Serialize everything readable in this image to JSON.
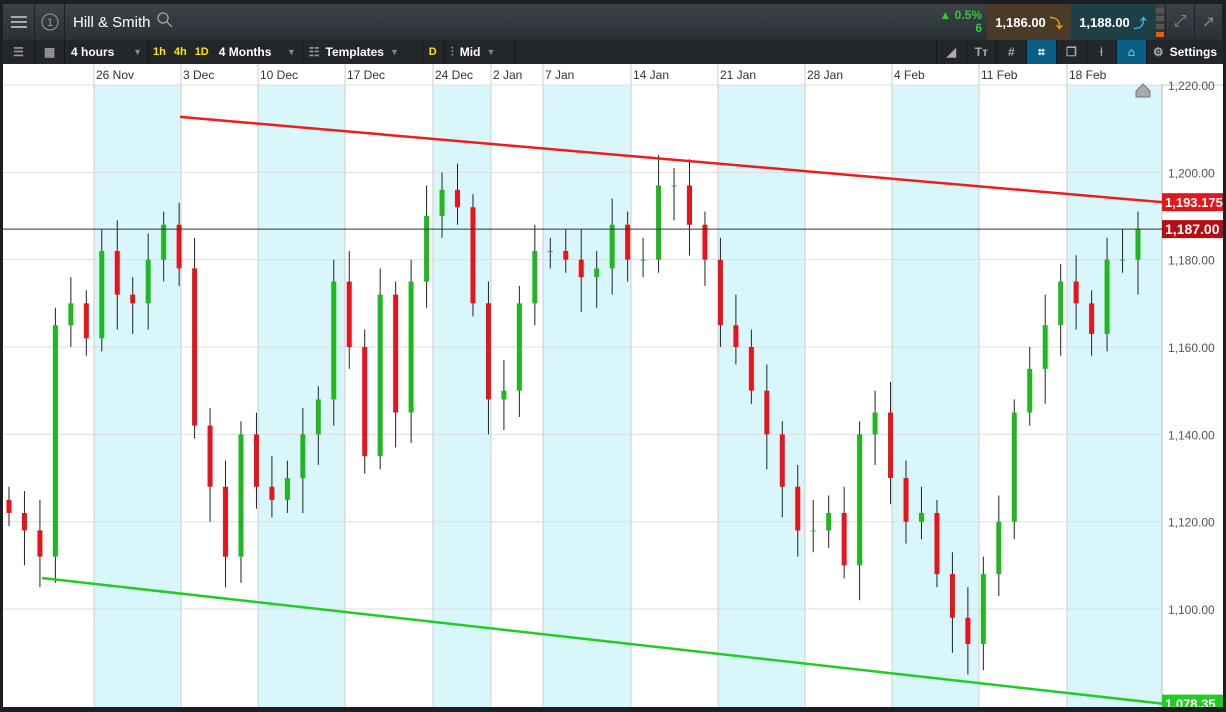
{
  "header": {
    "title": "Hill & Smith",
    "change_pct": "0.5%",
    "change_abs": "6",
    "sell_price": "1,186.00",
    "buy_price": "1,188.00"
  },
  "toolbar": {
    "interval": "4 hours",
    "quick": [
      "1h",
      "4h",
      "1D"
    ],
    "range": "4 Months",
    "templates": "Templates",
    "d_label": "D",
    "price_type": "Mid",
    "settings": "Settings"
  },
  "colors": {
    "up": "#1fb81f",
    "down": "#e8141b",
    "resistance": "#ee1c1c",
    "support": "#22cc22",
    "shade": "#d9f7fb"
  },
  "chart_data": {
    "type": "candlestick",
    "x_ticks": [
      "26 Nov",
      "3 Dec",
      "10 Dec",
      "17 Dec",
      "24 Dec",
      "2 Jan",
      "7 Jan",
      "14 Jan",
      "21 Jan",
      "28 Jan",
      "4 Feb",
      "11 Feb",
      "18 Feb"
    ],
    "y_ticks": [
      "1,220.00",
      "1,200.00",
      "1,180.00",
      "1,160.00",
      "1,140.00",
      "1,120.00",
      "1,100.00"
    ],
    "ylim": [
      1076,
      1224
    ],
    "closes": [
      1122,
      1118,
      1112,
      1165,
      1170,
      1162,
      1182,
      1172,
      1170,
      1180,
      1188,
      1178,
      1142,
      1128,
      1112,
      1140,
      1128,
      1125,
      1130,
      1140,
      1148,
      1175,
      1160,
      1135,
      1172,
      1145,
      1175,
      1190,
      1196,
      1192,
      1170,
      1148,
      1150,
      1170,
      1182,
      1182,
      1180,
      1176,
      1178,
      1188,
      1180,
      1180,
      1197,
      1197,
      1188,
      1180,
      1165,
      1160,
      1150,
      1140,
      1128,
      1118,
      1118,
      1122,
      1110,
      1140,
      1145,
      1130,
      1120,
      1122,
      1108,
      1098,
      1092,
      1108,
      1120,
      1145,
      1155,
      1165,
      1175,
      1170,
      1163,
      1180,
      1180,
      1187
    ],
    "resistance_line": {
      "start": 1212.7,
      "end": 1193.17,
      "label": "1,193.175"
    },
    "support_line": {
      "start": 1107.1,
      "end": 1078.35,
      "label": "1,078.35"
    },
    "last_price": {
      "value": 1187,
      "label": "1,187.00"
    }
  }
}
